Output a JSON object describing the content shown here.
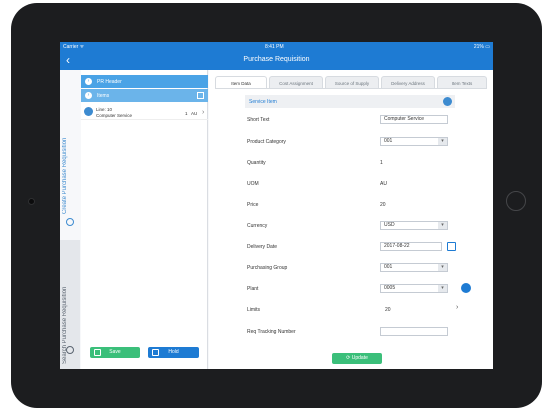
{
  "status_bar": {
    "carrier": "Carrier ᯤ",
    "time": "8:41 PM",
    "battery": "21% ▭"
  },
  "nav": {
    "back_icon": "chevron-left-icon",
    "title": "Purchase Requisition"
  },
  "side_tabs": {
    "create": "Create Purchase Requisition",
    "search": "Search Purchase Requisition"
  },
  "left_panel": {
    "pr_header": "PR Header",
    "items": "Items",
    "item": {
      "line": "Line: 10",
      "description": "Computer Service",
      "quantity": "1",
      "uom": "AU"
    },
    "save_label": "Save",
    "hold_label": "Hold"
  },
  "tabs": [
    "Item Data",
    "Cost Assignment",
    "Source of Supply",
    "Delivery Address",
    "Item Texts"
  ],
  "form": {
    "section": "Service Item",
    "fields": [
      {
        "label": "Short Text",
        "value": "Computer Service"
      },
      {
        "label": "Product Category",
        "value": "001"
      },
      {
        "label": "Quantity",
        "value": "1"
      },
      {
        "label": "UOM",
        "value": "AU"
      },
      {
        "label": "Price",
        "value": "20"
      },
      {
        "label": "Currency",
        "value": "USD"
      },
      {
        "label": "Delivery Date",
        "value": "2017-08-22"
      },
      {
        "label": "Purchasing Group",
        "value": "001"
      },
      {
        "label": "Plant",
        "value": "0005"
      },
      {
        "label": "Limits",
        "value": "20"
      },
      {
        "label": "Req Tracking Number",
        "value": ""
      }
    ],
    "update_label": "Update"
  },
  "colors": {
    "primary": "#1e7bd3",
    "accent": "#4aa3e6",
    "success": "#3bbf7a"
  }
}
